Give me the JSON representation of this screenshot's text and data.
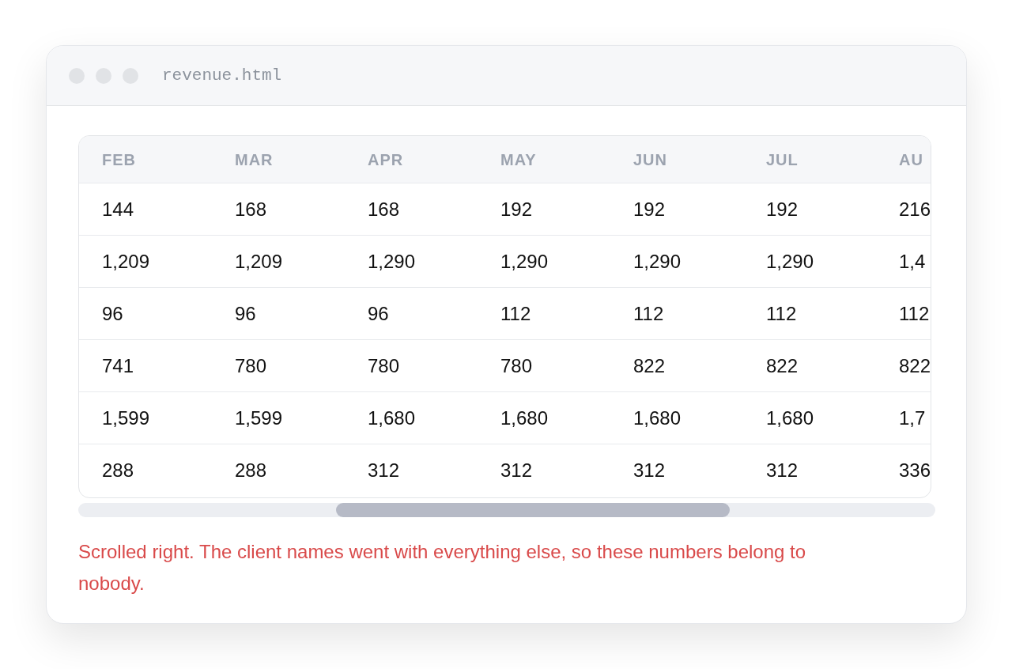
{
  "window": {
    "title": "revenue.html"
  },
  "table": {
    "columns": [
      "FEB",
      "MAR",
      "APR",
      "MAY",
      "JUN",
      "JUL",
      "AU"
    ],
    "rows": [
      [
        "144",
        "168",
        "168",
        "192",
        "192",
        "192",
        "216"
      ],
      [
        "1,209",
        "1,209",
        "1,290",
        "1,290",
        "1,290",
        "1,290",
        "1,4"
      ],
      [
        "96",
        "96",
        "96",
        "112",
        "112",
        "112",
        "112"
      ],
      [
        "741",
        "780",
        "780",
        "780",
        "822",
        "822",
        "822"
      ],
      [
        "1,599",
        "1,599",
        "1,680",
        "1,680",
        "1,680",
        "1,680",
        "1,7"
      ],
      [
        "288",
        "288",
        "312",
        "312",
        "312",
        "312",
        "336"
      ]
    ]
  },
  "note": "Scrolled right. The client names went with everything else, so these numbers belong to nobody."
}
